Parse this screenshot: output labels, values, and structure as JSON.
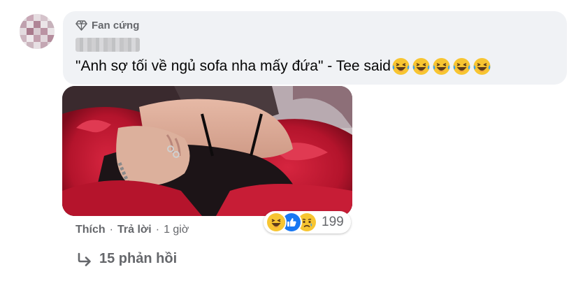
{
  "comment": {
    "badge_label": "Fan cứng",
    "text": "\"Anh sợ tối về ngủ sofa nha mấy đứa\" - Tee said",
    "emoji_count": 5
  },
  "actions": {
    "like_label": "Thích",
    "separator": "·",
    "reply_label": "Trả lời",
    "time_label": "1 giờ"
  },
  "reactions": {
    "types": [
      "haha",
      "like",
      "sad"
    ],
    "count": "199"
  },
  "replies": {
    "label": "15 phản hồi"
  },
  "colors": {
    "bubble": "#f0f2f5",
    "secondary_text": "#65676b",
    "like_blue": "#1877f2",
    "emoji_yellow": "#f7c531"
  }
}
